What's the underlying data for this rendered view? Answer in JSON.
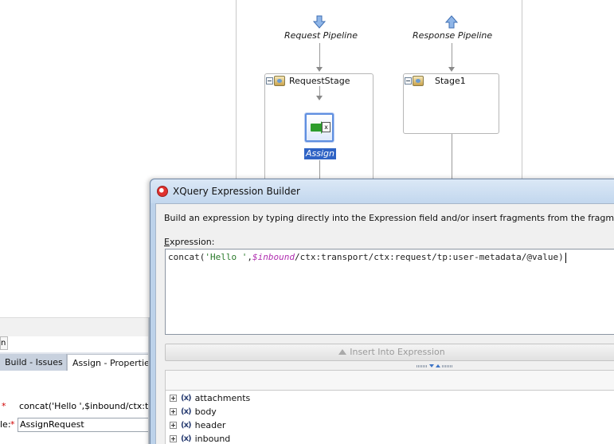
{
  "pipeline": {
    "request_label": "Request Pipeline",
    "response_label": "Response Pipeline",
    "request_stage": "RequestStage",
    "response_stage": "Stage1",
    "assign_label": "Assign",
    "assign_icon_glyph": "x"
  },
  "properties": {
    "cut_tab": "n",
    "tabs": [
      {
        "label": "Build - Issues",
        "active": false
      },
      {
        "label": "Assign - Properties",
        "active": true
      }
    ],
    "required_marker": "*",
    "expression_value": "concat('Hello ',$inbound/ctx:transpo",
    "variable_label": "le:",
    "variable_value": "AssignRequest"
  },
  "dialog": {
    "title": "XQuery Expression Builder",
    "description": "Build an expression by typing directly into the Expression field and/or insert fragments from the fragment editors below",
    "expression_label_underlined": "E",
    "expression_label_rest": "xpression:",
    "expression": {
      "fn": "concat(",
      "string": "'Hello '",
      "comma": ",",
      "variable": "$inbound",
      "path": "/ctx:transport/ctx:request/tp:user-metadata/@value)"
    },
    "insert_button": "Insert Into Expression",
    "tree": [
      {
        "label": "attachments",
        "icon": "x"
      },
      {
        "label": "body",
        "icon": "x"
      },
      {
        "label": "header",
        "icon": "x"
      },
      {
        "label": "inbound",
        "icon": "x"
      }
    ],
    "tree_icon_parts": {
      "open": "(",
      "x": "x",
      "close": ")"
    }
  },
  "colors": {
    "selection": "#2f63c5",
    "dialog_frame": "#bcd2ea",
    "xquery_string": "#2a7a2a",
    "xquery_variable": "#b02db0"
  }
}
